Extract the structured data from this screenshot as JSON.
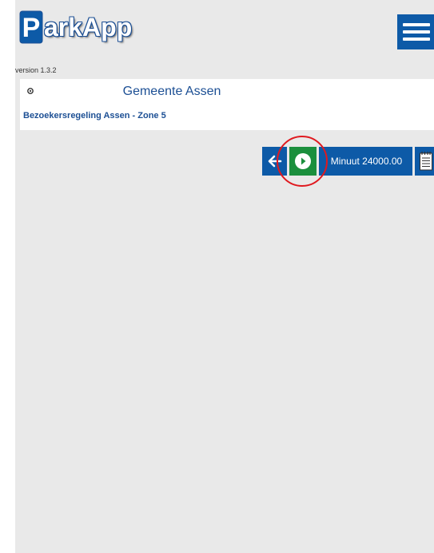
{
  "app": {
    "logo_letter": "P",
    "logo_text": "arkApp",
    "version": "version 1.3.2"
  },
  "header": {
    "menu_icon": "hamburger-menu-icon"
  },
  "location": {
    "settings_icon": "gear-icon",
    "municipality": "Gemeente Assen",
    "regulation": "Bezoekersregeling Assen - Zone 5"
  },
  "controls": {
    "back_icon": "arrow-left-icon",
    "play_icon": "play-circle-icon",
    "minute_label": "Minuut 24000.00",
    "note_icon": "notepad-icon"
  },
  "colors": {
    "brand_blue": "#0d5aa7",
    "text_blue": "#1c4f94",
    "start_green": "#1b8f3d",
    "highlight_red": "#e0191f",
    "background": "#e9e9e9"
  }
}
